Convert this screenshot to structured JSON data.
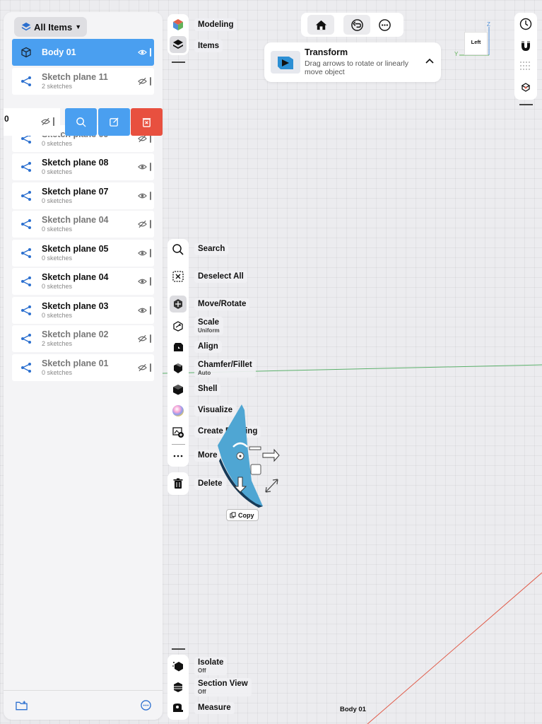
{
  "sidebar": {
    "filter_label": "All Items",
    "items": [
      {
        "name": "Body 01",
        "sub": "",
        "type": "body",
        "selected": true,
        "visible": true
      },
      {
        "name": "Sketch plane 11",
        "sub": "2 sketches",
        "type": "sketch",
        "selected": false,
        "visible": false
      },
      {
        "name": "Sketch plane 09",
        "sub": "0 sketches",
        "type": "sketch",
        "selected": false,
        "visible": false
      },
      {
        "name": "Sketch plane 08",
        "sub": "0 sketches",
        "type": "sketch",
        "selected": false,
        "visible": true
      },
      {
        "name": "Sketch plane 07",
        "sub": "0 sketches",
        "type": "sketch",
        "selected": false,
        "visible": true
      },
      {
        "name": "Sketch plane 04",
        "sub": "0 sketches",
        "type": "sketch",
        "selected": false,
        "visible": false
      },
      {
        "name": "Sketch plane 05",
        "sub": "0 sketches",
        "type": "sketch",
        "selected": false,
        "visible": true
      },
      {
        "name": "Sketch plane 04",
        "sub": "0 sketches",
        "type": "sketch",
        "selected": false,
        "visible": true
      },
      {
        "name": "Sketch plane 03",
        "sub": "0 sketches",
        "type": "sketch",
        "selected": false,
        "visible": true
      },
      {
        "name": "Sketch plane 02",
        "sub": "2 sketches",
        "type": "sketch",
        "selected": false,
        "visible": false
      },
      {
        "name": "Sketch plane 01",
        "sub": "0 sketches",
        "type": "sketch",
        "selected": false,
        "visible": false
      }
    ],
    "swiped_row_fragment": "0"
  },
  "modes": {
    "modeling": "Modeling",
    "items": "Items"
  },
  "transform_card": {
    "title": "Transform",
    "description": "Drag arrows to rotate or linearly move object"
  },
  "viewcube": {
    "face": "Left",
    "axis_z": "Z",
    "axis_y": "Y"
  },
  "tools": {
    "search": "Search",
    "deselect_all": "Deselect All",
    "move_rotate": "Move/Rotate",
    "scale": "Scale",
    "scale_sub": "Uniform",
    "align": "Align",
    "chamfer_fillet": "Chamfer/Fillet",
    "chamfer_fillet_sub": "Auto",
    "shell": "Shell",
    "visualize": "Visualize",
    "create_drawing": "Create Drawing",
    "more": "More",
    "delete": "Delete"
  },
  "bottom_tools": {
    "isolate": "Isolate",
    "isolate_sub": "Off",
    "section_view": "Section View",
    "section_view_sub": "Off",
    "measure": "Measure"
  },
  "gizmo": {
    "copy_label": "Copy"
  },
  "status": {
    "object_name": "Body 01"
  },
  "colors": {
    "accent": "#4a9ff0",
    "danger": "#e8503f",
    "object": "#4fa6d3",
    "x_axis": "#e05a48",
    "y_axis": "#5ab06a"
  }
}
